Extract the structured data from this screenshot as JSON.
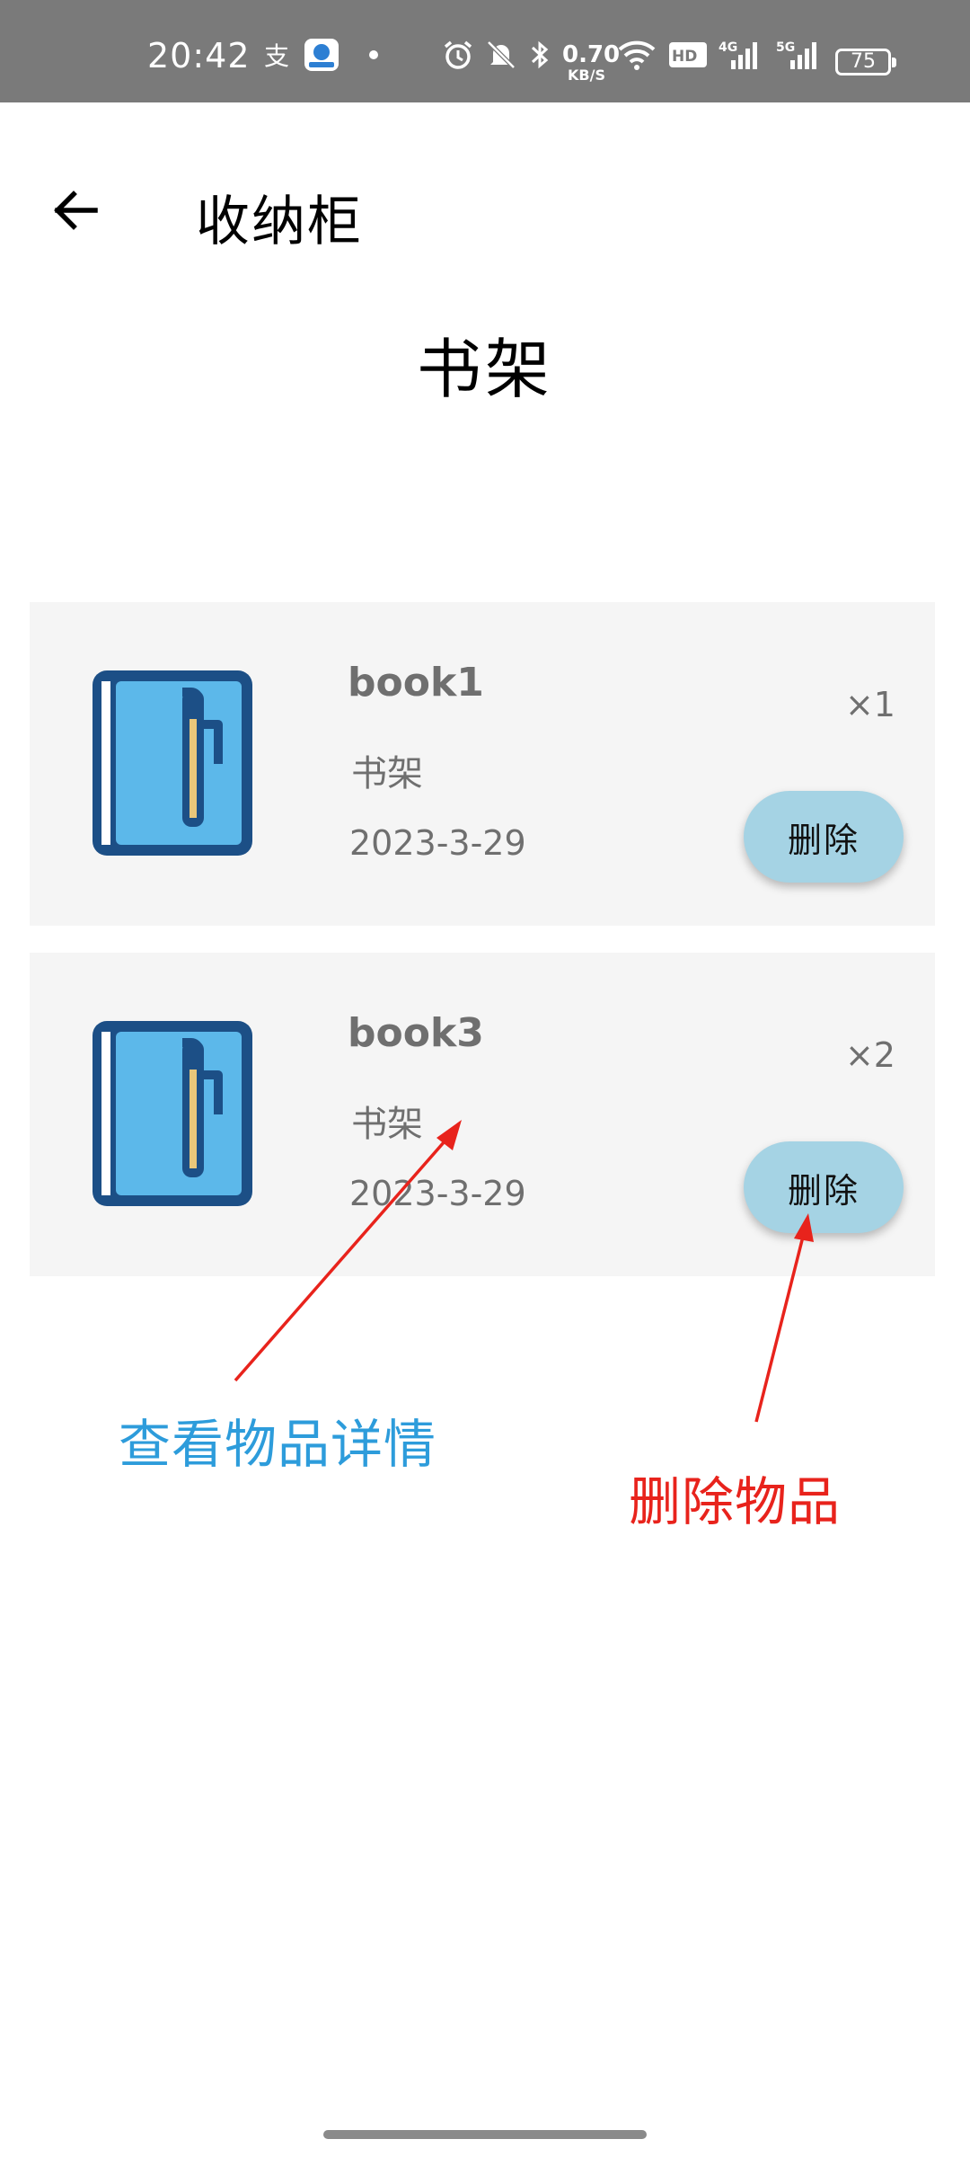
{
  "status_bar": {
    "time": "20:42",
    "net_speed_value": "0.70",
    "net_speed_unit": "KB/S",
    "signal_1": "4G",
    "signal_2": "5G",
    "hd_label": "HD",
    "battery": "75",
    "icons": [
      "alipay-icon",
      "app-icon",
      "dot-icon",
      "alarm-icon",
      "mute-bell-icon",
      "bluetooth-icon",
      "wifi-icon",
      "hd-icon",
      "signal-4g-icon",
      "signal-5g-icon",
      "battery-icon"
    ]
  },
  "app_bar": {
    "back_icon": "arrow-left-icon",
    "title": "收纳柜"
  },
  "page": {
    "heading": "书架"
  },
  "items": [
    {
      "name": "book1",
      "location": "书架",
      "date": "2023-3-29",
      "quantity": "×1",
      "delete_label": "删除",
      "icon": "notebook-icon"
    },
    {
      "name": "book3",
      "location": "书架",
      "date": "2023-3-29",
      "quantity": "×2",
      "delete_label": "删除",
      "icon": "notebook-icon"
    }
  ],
  "annotations": {
    "view_details": "查看物品详情",
    "delete_item": "删除物品"
  },
  "colors": {
    "status_bar_bg": "#7a7a7a",
    "card_bg": "#f5f5f5",
    "delete_button_bg": "#a5d3e4",
    "annotation_blue": "#2d9cdb",
    "annotation_red": "#e8231c",
    "notebook_dark": "#1c4f86",
    "notebook_light": "#5cb8ea",
    "pen_yellow": "#e9c77a"
  }
}
